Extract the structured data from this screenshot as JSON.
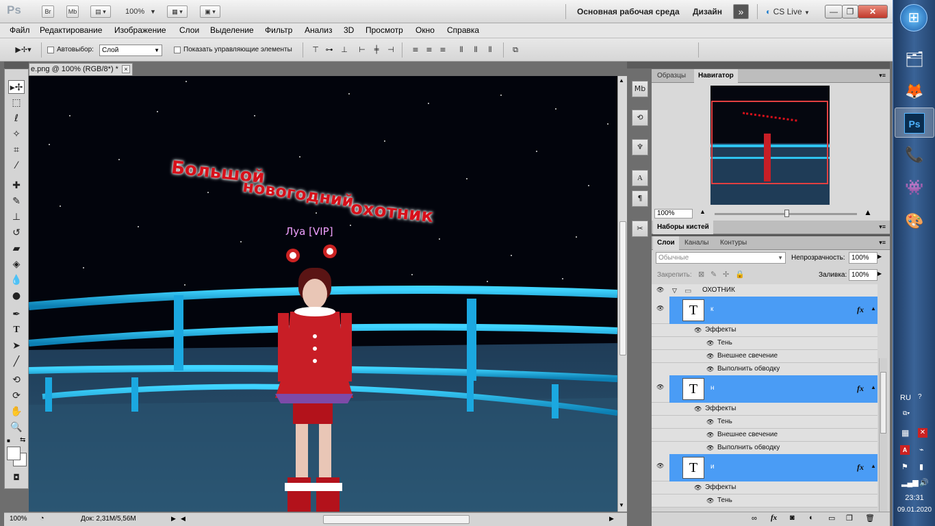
{
  "titlebar": {
    "app_logo": "Ps",
    "bridge": "Br",
    "mini_bridge": "Mb",
    "zoom": "100%",
    "workspace": "Основная рабочая среда",
    "design": "Дизайн",
    "cs_live": "CS Live",
    "more_icon": "double-chevron-icon"
  },
  "menu": [
    "Файл",
    "Редактирование",
    "Изображение",
    "Слои",
    "Выделение",
    "Фильтр",
    "Анализ",
    "3D",
    "Просмотр",
    "Окно",
    "Справка"
  ],
  "options": {
    "auto_select_label": "Автовыбор:",
    "auto_select_value": "Слой",
    "show_controls_label": "Показать управляющие элементы"
  },
  "document": {
    "tab_title": "e.png @ 100% (RGB/8*) *",
    "close": "×",
    "game_title_lines": [
      "Большой",
      "новогодний",
      "охотник"
    ],
    "player_name": "Луа [VIP]"
  },
  "status": {
    "zoom": "100%",
    "doc_info": "Док: 2,31M/5,56M"
  },
  "navigator": {
    "tabs": [
      "Образцы",
      "Навигатор"
    ],
    "active_tab": "Навигатор",
    "zoom": "100%"
  },
  "brushes_panel": {
    "title": "Наборы кистей"
  },
  "layers": {
    "tabs": [
      "Слои",
      "Каналы",
      "Контуры"
    ],
    "active_tab": "Слои",
    "blend_mode": "Обычные",
    "opacity_label": "Непрозрачность:",
    "opacity_value": "100%",
    "lock_label": "Закрепить:",
    "fill_label": "Заливка:",
    "fill_value": "100%",
    "group_name": "ОХОТНИК",
    "text_layers": [
      {
        "name": "к",
        "thumb": "T",
        "effects_label": "Эффекты",
        "effects": [
          "Тень",
          "Внешнее свечение",
          "Выполнить обводку"
        ]
      },
      {
        "name": "н",
        "thumb": "T",
        "effects_label": "Эффекты",
        "effects": [
          "Тень",
          "Внешнее свечение",
          "Выполнить обводку"
        ]
      },
      {
        "name": "и",
        "thumb": "T",
        "effects_label": "Эффекты",
        "effects": [
          "Тень"
        ]
      }
    ],
    "fx_label": "fx"
  },
  "taskbar": {
    "lang": "RU",
    "time": "23:31",
    "date": "09.01.2020"
  }
}
